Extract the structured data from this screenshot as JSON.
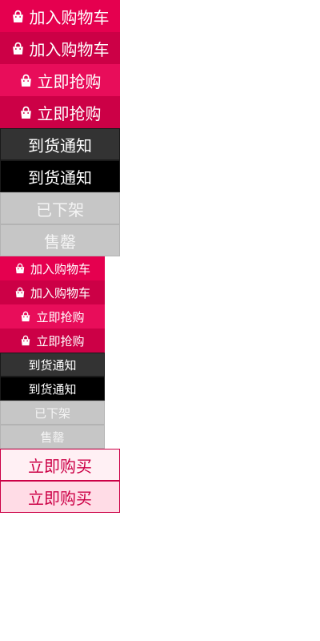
{
  "large_buttons": {
    "add_to_cart": "加入购物车",
    "add_to_cart_hover": "加入购物车",
    "buy_now": "立即抢购",
    "buy_now_hover": "立即抢购",
    "notify": "到货通知",
    "notify_hover": "到货通知",
    "off_shelf": "已下架",
    "sold_out": "售罄"
  },
  "small_buttons": {
    "add_to_cart": "加入购物车",
    "add_to_cart_hover": "加入购物车",
    "buy_now": "立即抢购",
    "buy_now_hover": "立即抢购",
    "notify": "到货通知",
    "notify_hover": "到货通知",
    "off_shelf": "已下架",
    "sold_out": "售罄"
  },
  "buy_buttons": {
    "buy_immediately": "立即购买",
    "buy_immediately_hover": "立即购买"
  },
  "icons": {
    "cart": "shopping-bag-icon"
  },
  "colors": {
    "pink": "#e5004f",
    "pink_dark": "#cc0046",
    "dark": "#333333",
    "black": "#000000",
    "gray": "#c6c6c6"
  }
}
